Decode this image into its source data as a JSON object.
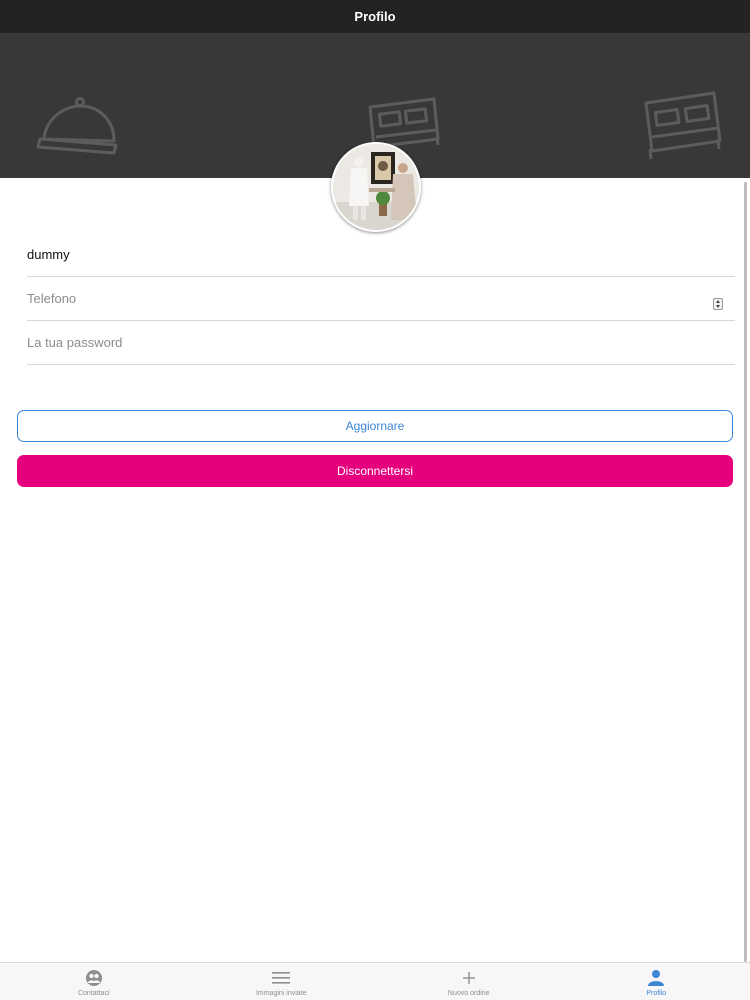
{
  "header": {
    "title": "Profilo"
  },
  "form": {
    "name_value": "dummy",
    "phone_placeholder": "Telefono",
    "password_placeholder": "La tua password"
  },
  "actions": {
    "update_label": "Aggiornare",
    "logout_label": "Disconnettersi"
  },
  "tabs": [
    {
      "label": "Contattaci",
      "icon": "contacts-icon",
      "active": false
    },
    {
      "label": "Immagini inviate",
      "icon": "list-icon",
      "active": false
    },
    {
      "label": "Nuovo ordine",
      "icon": "plus-icon",
      "active": false
    },
    {
      "label": "Profilo",
      "icon": "person-icon",
      "active": true
    }
  ],
  "colors": {
    "nav_bar": "#232323",
    "banner": "#383838",
    "accent_blue": "#3d86d6",
    "logout_pink": "#e6007e"
  }
}
